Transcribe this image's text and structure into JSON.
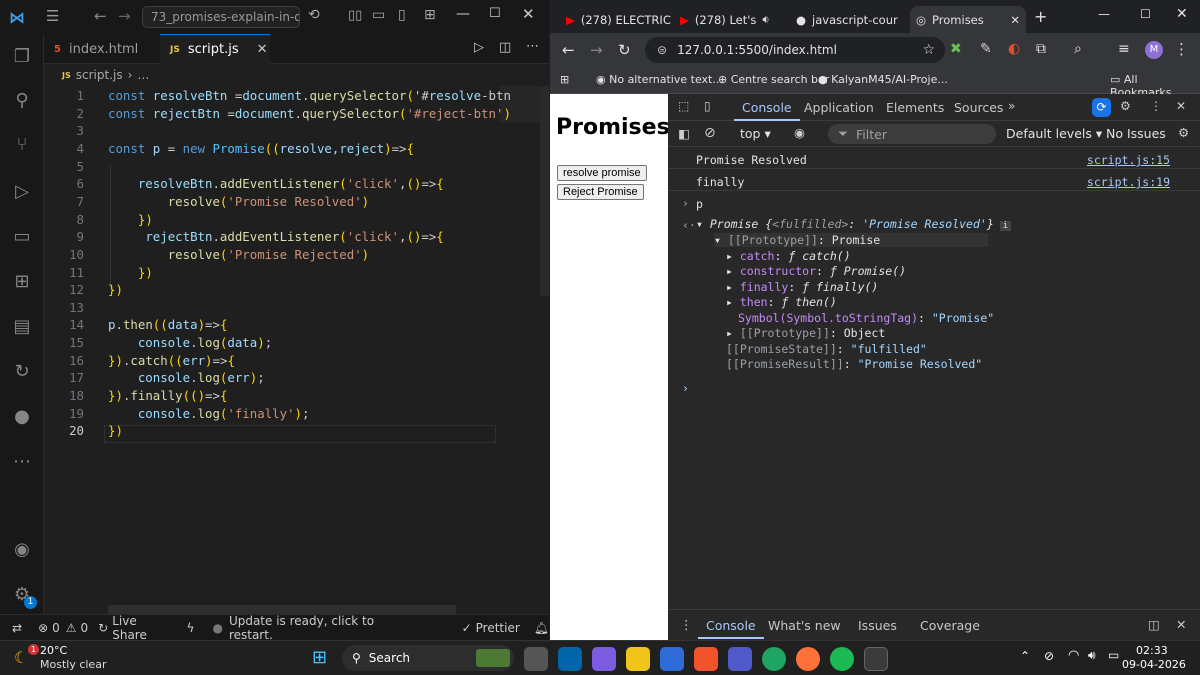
{
  "vscode": {
    "title": "73_promises-explain-in-de...",
    "tabs": [
      "index.html",
      "script.js"
    ],
    "breadcrumb": {
      "file": "script.js",
      "rest": "…"
    },
    "line_numbers": [
      "1",
      "2",
      "3",
      "4",
      "5",
      "6",
      "7",
      "8",
      "9",
      "10",
      "11",
      "12",
      "13",
      "14",
      "15",
      "16",
      "17",
      "18",
      "19",
      "20"
    ],
    "code": [
      "const resolveBtn =document.querySelector('#resolve-btn",
      "const rejectBtn =document.querySelector('#reject-btn')",
      "",
      "const p = new Promise((resolve,reject)=>{",
      "",
      "    resolveBtn.addEventListener('click',()=>{",
      "        resolve('Promise Resolved')",
      "    })",
      "     rejectBtn.addEventListener('click',()=>{",
      "        resolve('Promise Rejected')",
      "    })",
      "})",
      "",
      "p.then((data)=>{",
      "    console.log(data);",
      "}).catch((err)=>{",
      "    console.log(err);",
      "}).finally(()=>{",
      "    console.log('finally');",
      "})"
    ],
    "status": {
      "errors": "0",
      "warnings": "0",
      "live_share": "Live Share",
      "update": "Update is ready, click to restart.",
      "prettier": "Prettier",
      "badge": "1"
    }
  },
  "browser": {
    "tabs": [
      "(278) ELECTRIC",
      "(278) Let's",
      "javascript-cour",
      "Promises"
    ],
    "url": "127.0.0.1:5500/index.html",
    "bookmarks": [
      "No alternative text...",
      "Centre search bar",
      "KalyanM45/AI-Proje...",
      "All Bookmarks"
    ],
    "profile": "M",
    "page": {
      "heading": "Promises",
      "resolve_btn": "resolve promise",
      "reject_btn": "Reject Promise"
    },
    "devtools": {
      "tabs": [
        "Console",
        "Application",
        "Elements",
        "Sources"
      ],
      "context": "top",
      "filter_placeholder": "Filter",
      "levels": "Default levels",
      "issues": "No Issues",
      "logs": [
        {
          "text": "Promise Resolved",
          "src": "script.js:15"
        },
        {
          "text": "finally",
          "src": "script.js:19"
        }
      ],
      "input": "p",
      "result": {
        "summary_a": "Promise {",
        "summary_key": "<fulfilled>",
        "summary_b": ": ",
        "summary_val": "'Promise Resolved'",
        "summary_c": "}",
        "proto": "[[Prototype]]",
        "proto_val": ": Promise",
        "entries": [
          {
            "k": "catch",
            "v": "ƒ catch()"
          },
          {
            "k": "constructor",
            "v": "ƒ Promise()"
          },
          {
            "k": "finally",
            "v": "ƒ finally()"
          },
          {
            "k": "then",
            "v": "ƒ then()"
          }
        ],
        "symbol_k": "Symbol(Symbol.toStringTag)",
        "symbol_v": "\"Promise\"",
        "proto2": "[[Prototype]]",
        "proto2_v": ": Object",
        "state_k": "[[PromiseState]]",
        "state_v": "\"fulfilled\"",
        "res_k": "[[PromiseResult]]",
        "res_v": "\"Promise Resolved\""
      },
      "drawer_tabs": [
        "Console",
        "What's new",
        "Issues",
        "Coverage"
      ]
    }
  },
  "taskbar": {
    "temp": "20°C",
    "weather": "Mostly clear",
    "search": "Search",
    "time": "02:33",
    "date": "09-04-2026",
    "weather_badge": "1"
  }
}
